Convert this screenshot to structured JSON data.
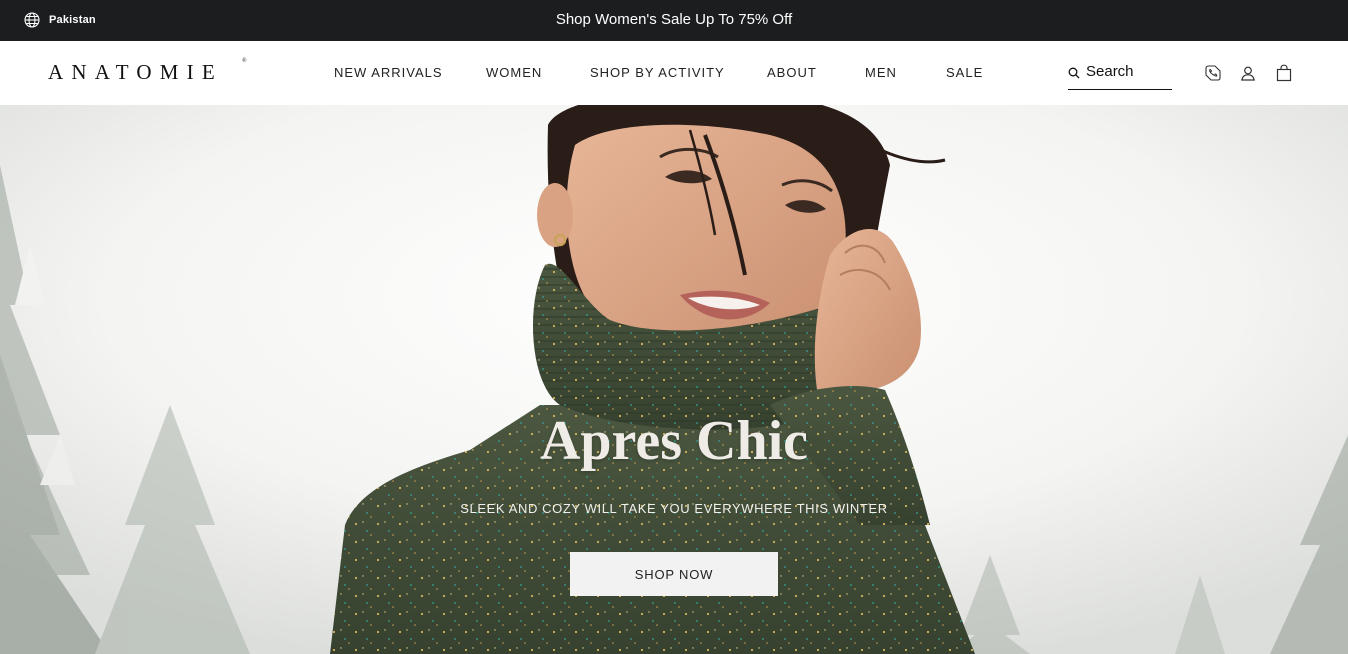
{
  "topbar": {
    "region_label": "Pakistan",
    "region_icon": "globe-icon",
    "promo_text": "Shop Women's Sale Up To 75% Off"
  },
  "header": {
    "logo_text": "ANATOMIE",
    "logo_mark": "®",
    "nav": [
      {
        "label": "NEW ARRIVALS"
      },
      {
        "label": "WOMEN"
      },
      {
        "label": "SHOP BY ACTIVITY"
      },
      {
        "label": "ABOUT"
      },
      {
        "label": "MEN"
      },
      {
        "label": "SALE"
      }
    ],
    "search": {
      "label": "Search",
      "icon": "search-icon"
    },
    "icons": [
      "chat-icon",
      "user-icon",
      "bag-icon"
    ]
  },
  "hero": {
    "title": "Apres Chic",
    "subtitle": "SLEEK AND COZY WILL TAKE YOU EVERYWHERE THIS WINTER",
    "cta_label": "SHOP NOW"
  },
  "colors": {
    "topbar_bg": "#1b1d1f",
    "sweater_green": "#3d4a34",
    "cta_bg": "#f2f2f2"
  }
}
